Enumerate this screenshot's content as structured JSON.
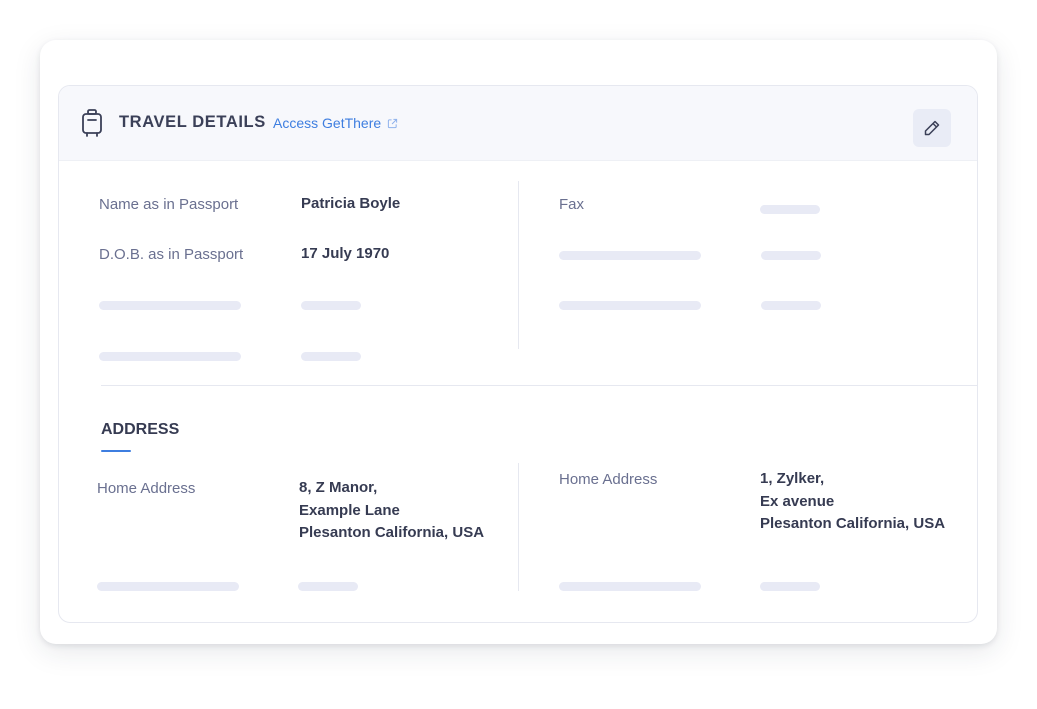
{
  "header": {
    "title": "TRAVEL DETAILS",
    "link_label": "Access GetThere",
    "icons": {
      "leading": "luggage-icon",
      "link": "external-link-icon",
      "edit": "pencil-icon"
    }
  },
  "passport": {
    "name_label": "Name as in Passport",
    "name_value": "Patricia Boyle",
    "dob_label": "D.O.B. as in Passport",
    "dob_value": "17 July 1970"
  },
  "contact": {
    "fax_label": "Fax"
  },
  "address": {
    "section_title": "ADDRESS",
    "left": {
      "label": "Home Address",
      "line1": "8, Z Manor,",
      "line2": "Example Lane",
      "line3": "Plesanton California, USA"
    },
    "right": {
      "label": "Home Address",
      "line1": "1, Zylker,",
      "line2": "Ex avenue",
      "line3": "Plesanton California, USA"
    }
  },
  "colors": {
    "accent": "#3e7ee0",
    "skeleton": "#e8eaf5",
    "header_bg": "#f7f8fc",
    "label_text": "#6a7090",
    "value_text": "#363b52"
  }
}
